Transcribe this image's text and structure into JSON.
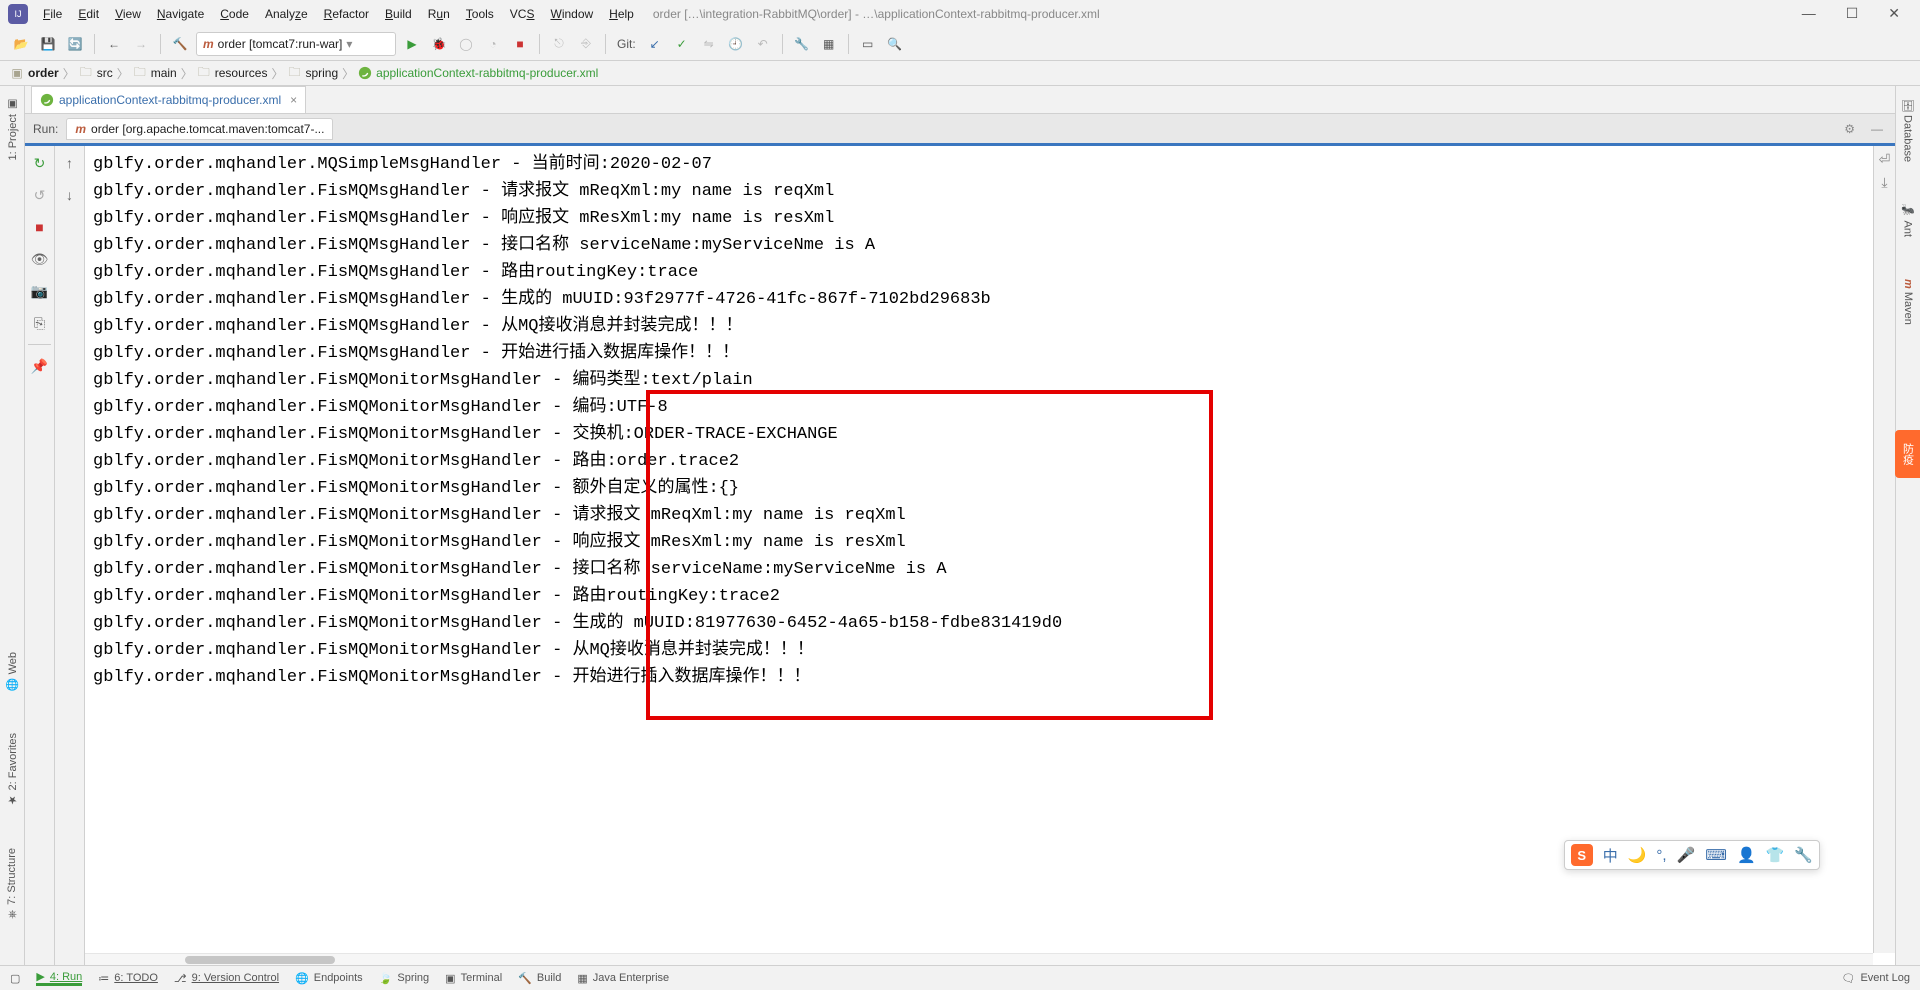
{
  "window": {
    "title": "order […\\integration-RabbitMQ\\order] - …\\applicationContext-rabbitmq-producer.xml"
  },
  "menubar": {
    "items": [
      "File",
      "Edit",
      "View",
      "Navigate",
      "Code",
      "Analyze",
      "Refactor",
      "Build",
      "Run",
      "Tools",
      "VCS",
      "Window",
      "Help"
    ]
  },
  "toolbar": {
    "run_config_label": "order [tomcat7:run-war]",
    "git_label": "Git:"
  },
  "breadcrumb": {
    "items": [
      "order",
      "src",
      "main",
      "resources",
      "spring",
      "applicationContext-rabbitmq-producer.xml"
    ]
  },
  "editor_tab": {
    "filename": "applicationContext-rabbitmq-producer.xml"
  },
  "run_panel": {
    "label": "Run:",
    "config": "order [org.apache.tomcat.maven:tomcat7-..."
  },
  "left_tabs": {
    "project": "1: Project",
    "web": "Web",
    "favorites": "2: Favorites",
    "structure": "7: Structure"
  },
  "right_tabs": {
    "database": "Database",
    "ant": "Ant",
    "maven": "Maven"
  },
  "console_lines": [
    "gblfy.order.mqhandler.MQSimpleMsgHandler - 当前时间:2020-02-07",
    "gblfy.order.mqhandler.FisMQMsgHandler - 请求报文 mReqXml:my name is reqXml",
    "gblfy.order.mqhandler.FisMQMsgHandler - 响应报文 mResXml:my name is resXml",
    "gblfy.order.mqhandler.FisMQMsgHandler - 接口名称 serviceName:myServiceNme is A",
    "gblfy.order.mqhandler.FisMQMsgHandler - 路由routingKey:trace",
    "gblfy.order.mqhandler.FisMQMsgHandler - 生成的 mUUID:93f2977f-4726-41fc-867f-7102bd29683b",
    "gblfy.order.mqhandler.FisMQMsgHandler - 从MQ接收消息并封装完成！！！",
    "gblfy.order.mqhandler.FisMQMsgHandler - 开始进行插入数据库操作！！！",
    "gblfy.order.mqhandler.FisMQMonitorMsgHandler - 编码类型:text/plain",
    "gblfy.order.mqhandler.FisMQMonitorMsgHandler - 编码:UTF-8",
    "gblfy.order.mqhandler.FisMQMonitorMsgHandler - 交换机:ORDER-TRACE-EXCHANGE",
    "gblfy.order.mqhandler.FisMQMonitorMsgHandler - 路由:order.trace2",
    "gblfy.order.mqhandler.FisMQMonitorMsgHandler - 额外自定义的属性:{}",
    "gblfy.order.mqhandler.FisMQMonitorMsgHandler - 请求报文 mReqXml:my name is reqXml",
    "gblfy.order.mqhandler.FisMQMonitorMsgHandler - 响应报文 mResXml:my name is resXml",
    "gblfy.order.mqhandler.FisMQMonitorMsgHandler - 接口名称 serviceName:myServiceNme is A",
    "gblfy.order.mqhandler.FisMQMonitorMsgHandler - 路由routingKey:trace2",
    "gblfy.order.mqhandler.FisMQMonitorMsgHandler - 生成的 mUUID:81977630-6452-4a65-b158-fdbe831419d0",
    "gblfy.order.mqhandler.FisMQMonitorMsgHandler - 从MQ接收消息并封装完成！！！",
    "gblfy.order.mqhandler.FisMQMonitorMsgHandler - 开始进行插入数据库操作！！！"
  ],
  "statusbar": {
    "run": "4: Run",
    "todo": "6: TODO",
    "vcs": "9: Version Control",
    "endpoints": "Endpoints",
    "spring": "Spring",
    "terminal": "Terminal",
    "build": "Build",
    "javaee": "Java Enterprise",
    "eventlog": "Event Log"
  },
  "float": {
    "badge": "防疫"
  }
}
